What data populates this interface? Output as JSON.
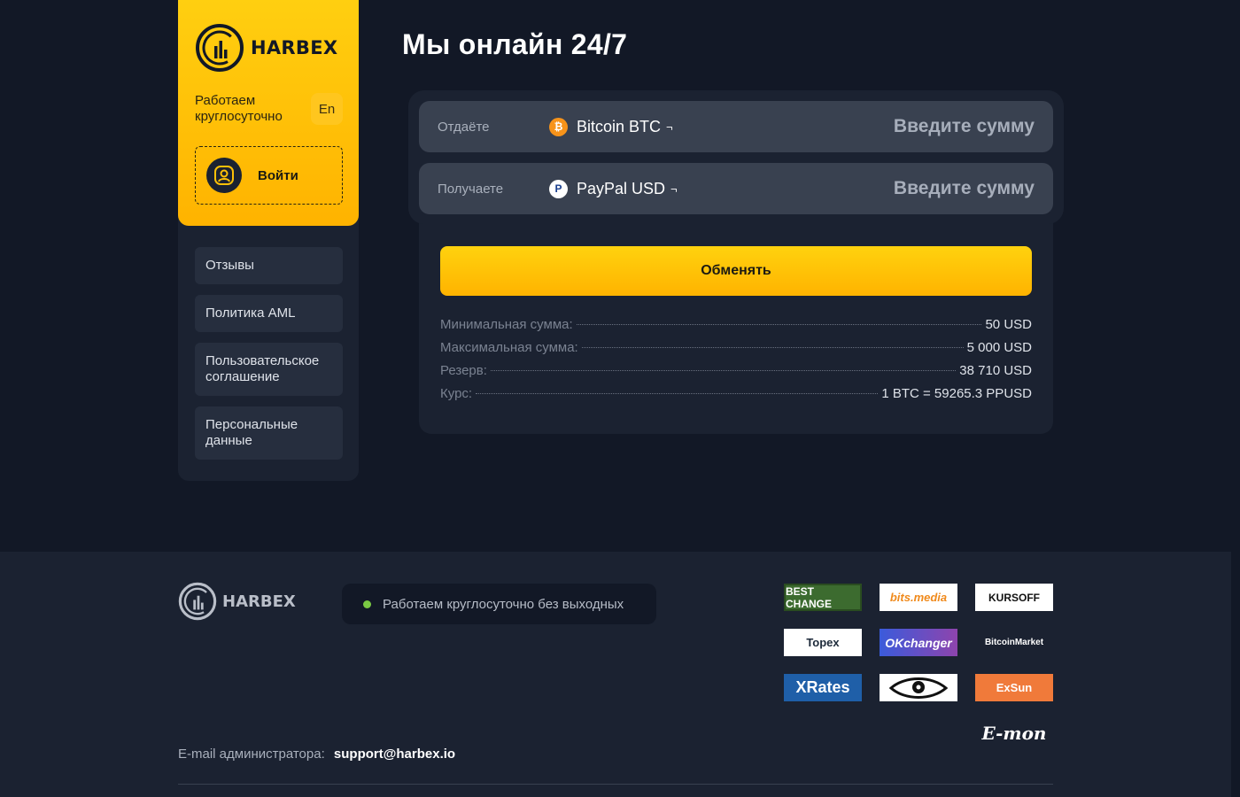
{
  "brand": {
    "name": "HARBEX"
  },
  "sidebar": {
    "work_text": "Работаем круглосуточно",
    "lang": "En",
    "login_label": "Войти",
    "items": [
      {
        "label": "Отзывы"
      },
      {
        "label": "Политика AML"
      },
      {
        "label": "Пользовательское соглашение"
      },
      {
        "label": "Персональные данные"
      }
    ]
  },
  "main": {
    "title": "Мы онлайн 24/7",
    "give": {
      "label": "Отдаёте",
      "currency": "Bitcoin BTC",
      "arrow": "¬",
      "placeholder": "Введите сумму",
      "icon": "bitcoin-icon"
    },
    "receive": {
      "label": "Получаете",
      "currency": "PayPal USD",
      "arrow": "¬",
      "placeholder": "Введите сумму",
      "icon": "paypal-icon"
    },
    "exchange_button": "Обменять",
    "info": [
      {
        "label": "Минимальная сумма:",
        "value": "50 USD"
      },
      {
        "label": "Максимальная сумма:",
        "value": "5 000 USD"
      },
      {
        "label": "Резерв:",
        "value": "38 710 USD"
      },
      {
        "label": "Курс:",
        "value": "1 BTC = 59265.3 PPUSD"
      }
    ]
  },
  "footer": {
    "status": "Работаем круглосуточно без выходных",
    "admin_label": "E-mail администратора:",
    "admin_email": "support@harbex.io",
    "partners": [
      {
        "label": "BEST CHANGE"
      },
      {
        "label": "bits.media"
      },
      {
        "label": "KURSOFF"
      },
      {
        "label": "Topex"
      },
      {
        "label": "OKchanger"
      },
      {
        "label": "BitcoinMarket"
      },
      {
        "label": "XRates"
      },
      {
        "label": ""
      },
      {
        "label": "ExSun"
      },
      {
        "label": "E-mon"
      }
    ]
  },
  "colors": {
    "accent": "#ffc107",
    "bg": "#121826",
    "card": "#1b2231",
    "input": "#394150",
    "status": "#7ac943"
  }
}
